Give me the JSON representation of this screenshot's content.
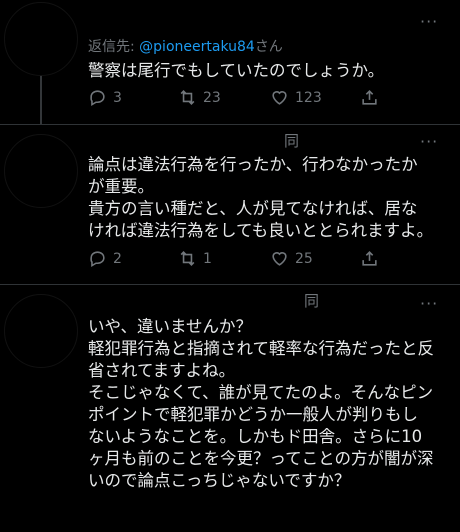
{
  "tweets": [
    {
      "reply_prefix": "返信先: ",
      "reply_handle": "@pioneertaku84",
      "reply_suffix": "さん",
      "body": "警察は尾行でもしていたのでしょうか。",
      "stats": {
        "replies": "3",
        "retweets": "23",
        "likes": "123"
      }
    },
    {
      "name_tail": "同",
      "body": "論点は違法行為を行ったか、行わなかったか\nが重要。\n貴方の言い種だと、人が見てなければ、居な\nければ違法行為をしても良いととられますよ。",
      "stats": {
        "replies": "2",
        "retweets": "1",
        "likes": "25"
      }
    },
    {
      "name_tail": "同",
      "body": "いや、違いませんか？\n軽犯罪行為と指摘されて軽率な行為だったと反\n省されてますよね。\nそこじゃなくて、誰が見てたのよ。そんなピン\nポイントで軽犯罪かどうか一般人が判りもし\nないようなことを。しかもド田舎。さらに10\nヶ月も前のことを今更？ってことの方が闇が深\nいので論点こっちじゃないですか？"
    }
  ],
  "more_label": "···",
  "colors": {
    "background": "#000000",
    "text": "#e7e9ea",
    "muted": "#71767b",
    "link": "#1d9bf0"
  },
  "icons": [
    "reply-icon",
    "retweet-icon",
    "like-icon",
    "share-icon",
    "more-icon"
  ]
}
